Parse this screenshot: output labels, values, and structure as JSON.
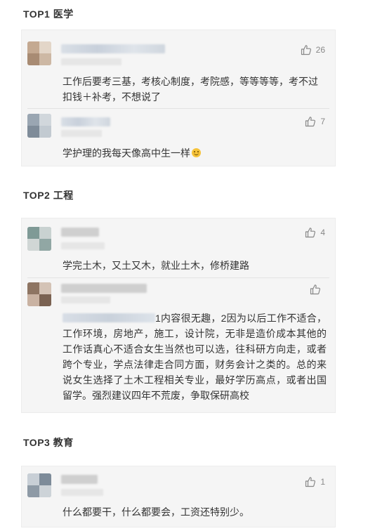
{
  "sections": [
    {
      "title": "TOP1 医学",
      "comments": [
        {
          "likes": "26",
          "text": "工作后要考三基，考核心制度，考院感，等等等等，考不过扣钱＋补考，不想说了"
        },
        {
          "likes": "7",
          "text": "学护理的我每天像高中生一样"
        }
      ]
    },
    {
      "title": "TOP2 工程",
      "comments": [
        {
          "likes": "4",
          "text": "学完土木，又土又木，就业土木，修桥建路"
        },
        {
          "likes": "",
          "text": "1内容很无趣，2因为以后工作不适合，工作环境，房地产，施工，设计院，无非是造价成本其他的工作话真心不适合女生当然也可以选，往科研方向走，或者跨个专业，学点法律走合同方面，财务会计之类的。总的来说女生选择了土木工程相关专业，最好学历高点，或者出国留学。强烈建议四年不荒废，争取保研高校"
        }
      ]
    },
    {
      "title": "TOP3 教育",
      "comments": [
        {
          "likes": "1",
          "text": "什么都要干，什么都要会，工资还特别少。"
        }
      ]
    }
  ],
  "icons": {
    "like": "thumbs-up-icon",
    "emoji": "smile-emoji-icon"
  },
  "colors": {
    "card_bg": "#f5f5f5",
    "text": "#333333",
    "muted": "#888888"
  }
}
